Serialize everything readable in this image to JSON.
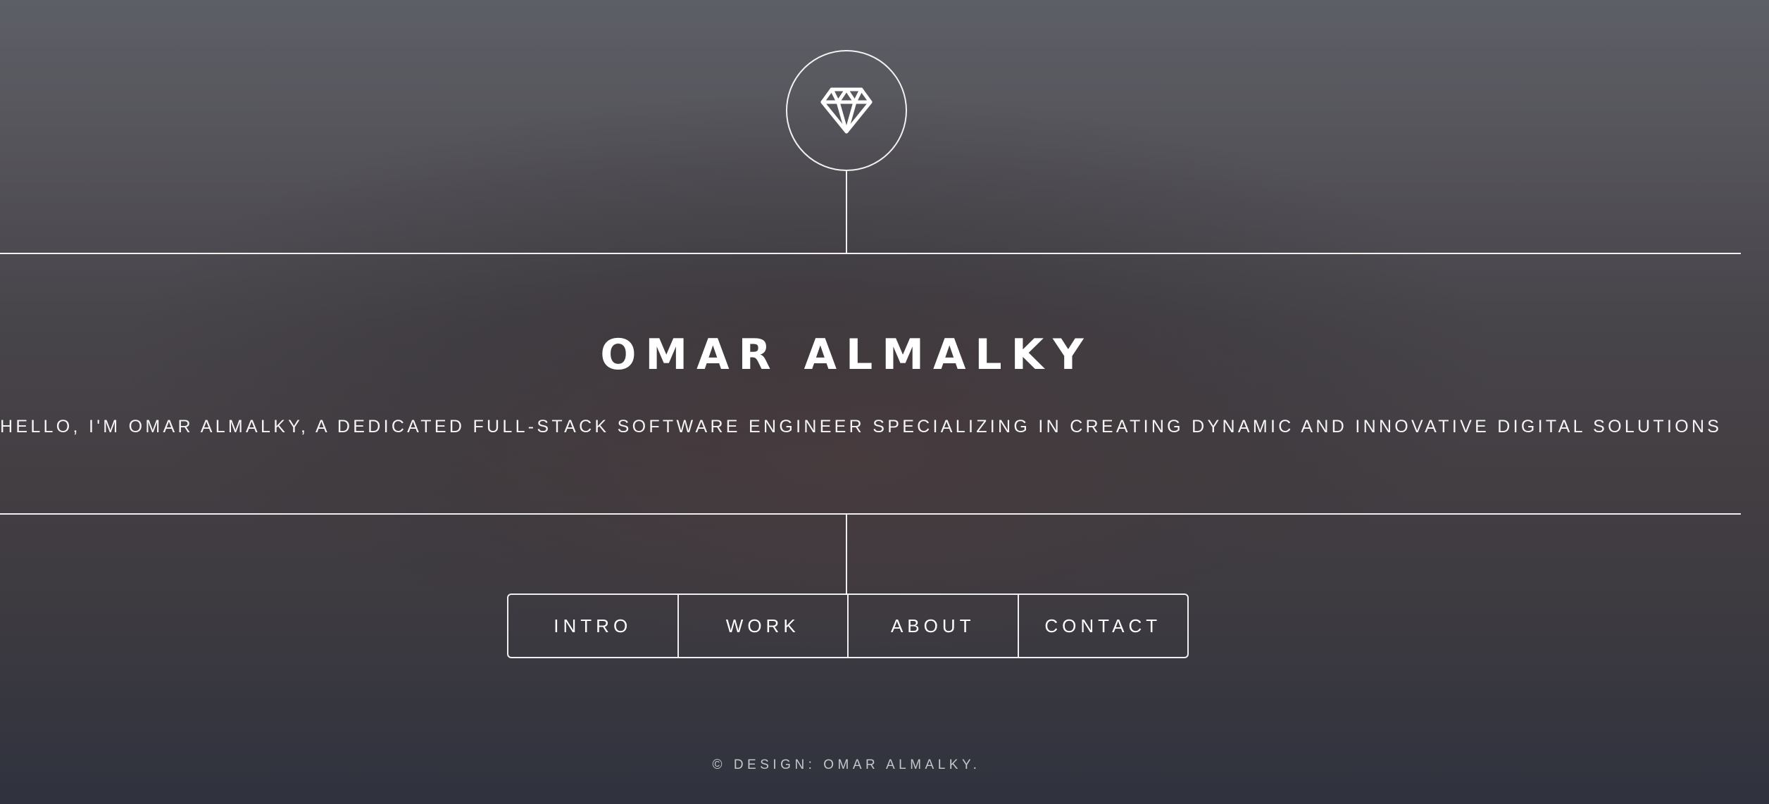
{
  "header": {
    "logo_icon": "diamond-icon"
  },
  "intro": {
    "title": "OMAR ALMALKY",
    "subtitle": "HELLO, I'M OMAR ALMALKY, A DEDICATED FULL-STACK SOFTWARE ENGINEER SPECIALIZING IN CREATING DYNAMIC AND INNOVATIVE DIGITAL SOLUTIONS"
  },
  "nav": {
    "items": [
      {
        "label": "INTRO"
      },
      {
        "label": "WORK"
      },
      {
        "label": "ABOUT"
      },
      {
        "label": "CONTACT"
      }
    ]
  },
  "footer": {
    "text": "© DESIGN: OMAR ALMALKY."
  },
  "colors": {
    "foreground": "#ffffff",
    "background_top": "#5d5f67",
    "background_bottom": "#2f323e"
  }
}
